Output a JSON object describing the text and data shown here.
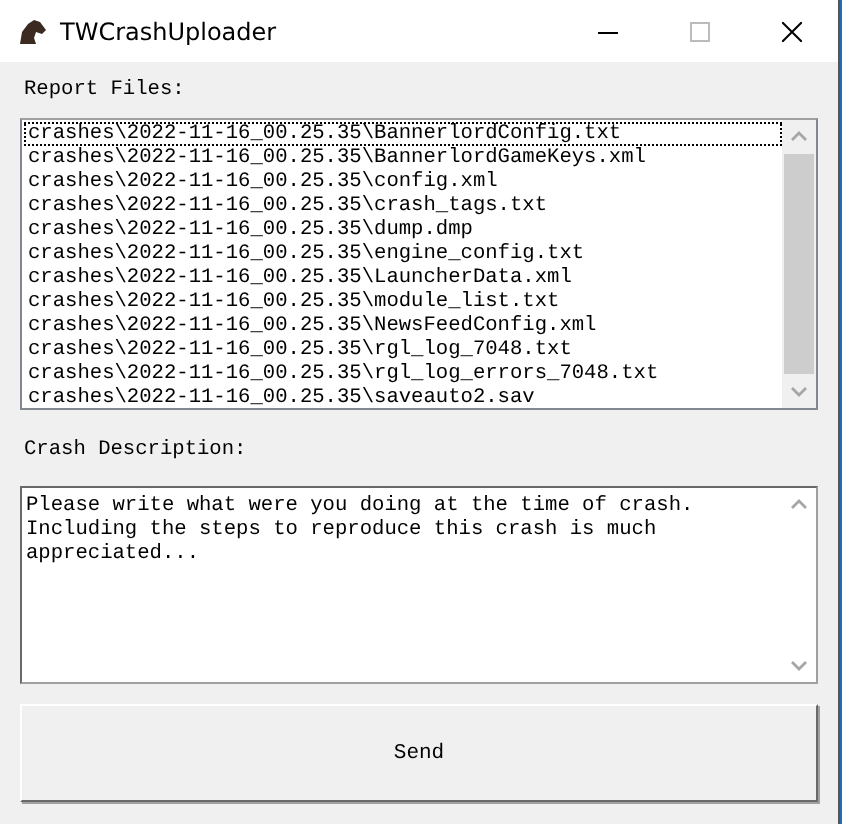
{
  "window": {
    "title": "TWCrashUploader"
  },
  "report_files": {
    "label": "Report Files:",
    "items": [
      {
        "text": "crashes\\2022-11-16_00.25.35\\BannerlordConfig.txt",
        "focused": true
      },
      {
        "text": "crashes\\2022-11-16_00.25.35\\BannerlordGameKeys.xml",
        "focused": false
      },
      {
        "text": "crashes\\2022-11-16_00.25.35\\config.xml",
        "focused": false
      },
      {
        "text": "crashes\\2022-11-16_00.25.35\\crash_tags.txt",
        "focused": false
      },
      {
        "text": "crashes\\2022-11-16_00.25.35\\dump.dmp",
        "focused": false
      },
      {
        "text": "crashes\\2022-11-16_00.25.35\\engine_config.txt",
        "focused": false
      },
      {
        "text": "crashes\\2022-11-16_00.25.35\\LauncherData.xml",
        "focused": false
      },
      {
        "text": "crashes\\2022-11-16_00.25.35\\module_list.txt",
        "focused": false
      },
      {
        "text": "crashes\\2022-11-16_00.25.35\\NewsFeedConfig.xml",
        "focused": false
      },
      {
        "text": "crashes\\2022-11-16_00.25.35\\rgl_log_7048.txt",
        "focused": false
      },
      {
        "text": "crashes\\2022-11-16_00.25.35\\rgl_log_errors_7048.txt",
        "focused": false
      },
      {
        "text": "crashes\\2022-11-16_00.25.35\\saveauto2.sav",
        "focused": false
      }
    ]
  },
  "crash_description": {
    "label": "Crash Description:",
    "value": "Please write what were you doing at the time of crash.\nIncluding the steps to reproduce this crash is much\nappreciated..."
  },
  "buttons": [
    {
      "label": "Send"
    }
  ]
}
